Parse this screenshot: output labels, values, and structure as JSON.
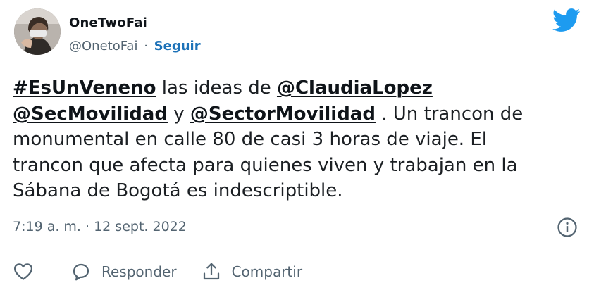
{
  "colors": {
    "twitter_blue": "#1d9bf0",
    "follow_link": "#1d72b8",
    "secondary_text": "#536471",
    "primary_text": "#0f1419",
    "divider": "#cfd9de"
  },
  "author": {
    "display_name": "OneTwoFai",
    "handle": "@OnetoFai",
    "separator": "·",
    "follow_label": "Seguir",
    "avatar_icon": "profile-photo"
  },
  "tweet": {
    "hashtag": "#EsUnVeneno",
    "text_1": " las ideas de ",
    "mention_1": "@ClaudiaLopez",
    "mention_2": "@SecMovilidad",
    "text_2": " y ",
    "mention_3": "@SectorMovilidad",
    "text_3": " . Un trancon de",
    "line_3": "monumental en calle 80 de casi 3 horas de viaje. El",
    "line_4": "trancon que  afecta para quienes viven y trabajan en la",
    "line_5": "Sábana de Bogotá es indescriptible."
  },
  "meta": {
    "timestamp": "7:19 a. m. · 12 sept. 2022",
    "info_icon": "info-icon"
  },
  "actions": {
    "like_icon": "heart-icon",
    "reply_icon": "speech-bubble-icon",
    "reply_label": "Responder",
    "share_icon": "share-icon",
    "share_label": "Compartir"
  }
}
